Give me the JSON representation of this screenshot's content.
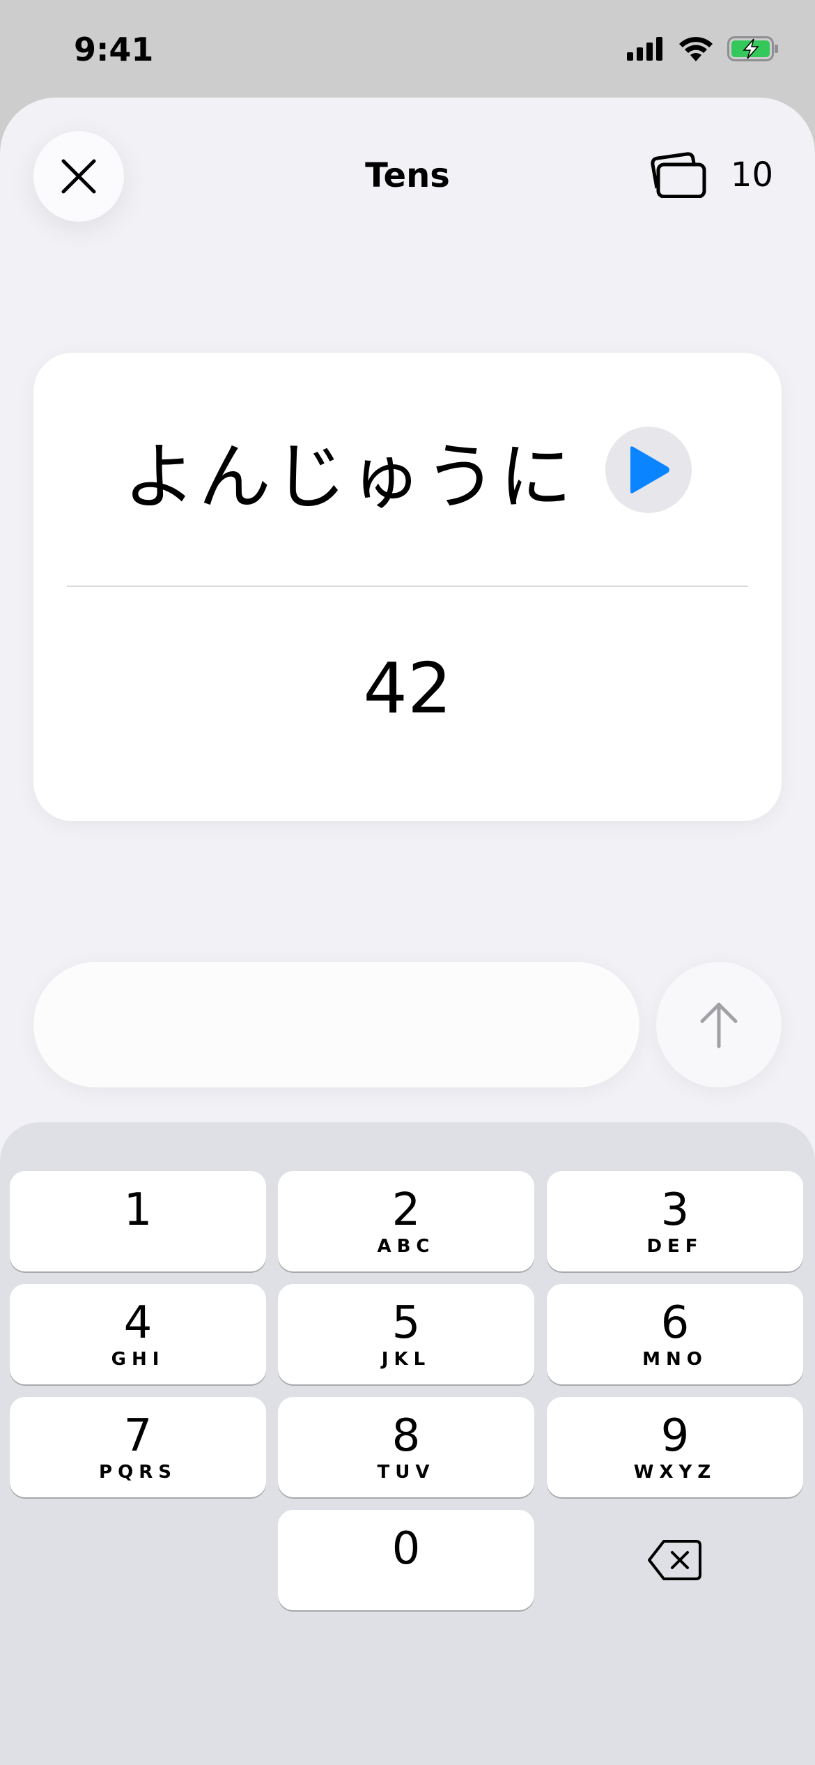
{
  "status_bar": {
    "time": "9:41"
  },
  "header": {
    "title": "Tens",
    "deck_count": "10"
  },
  "card": {
    "kana": "よんじゅうに",
    "number": "42"
  },
  "answer": {
    "value": "",
    "placeholder": ""
  },
  "keypad": {
    "keys": [
      {
        "num": "1",
        "letters": ""
      },
      {
        "num": "2",
        "letters": "ABC"
      },
      {
        "num": "3",
        "letters": "DEF"
      },
      {
        "num": "4",
        "letters": "GHI"
      },
      {
        "num": "5",
        "letters": "JKL"
      },
      {
        "num": "6",
        "letters": "MNO"
      },
      {
        "num": "7",
        "letters": "PQRS"
      },
      {
        "num": "8",
        "letters": "TUV"
      },
      {
        "num": "9",
        "letters": "WXYZ"
      },
      {
        "num": "0",
        "letters": ""
      }
    ]
  },
  "colors": {
    "accent": "#0a84ff",
    "battery": "#34c759"
  }
}
